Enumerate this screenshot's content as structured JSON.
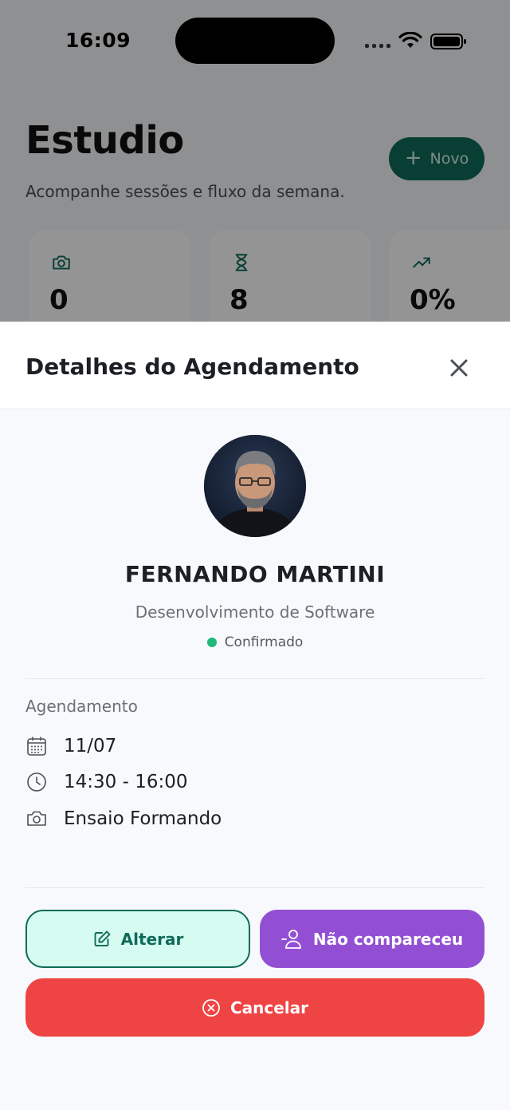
{
  "status_bar": {
    "time": "16:09"
  },
  "background": {
    "title": "Estudio",
    "subtitle": "Acompanhe sessões e fluxo da semana.",
    "new_button": "Novo",
    "stats": [
      {
        "icon": "camera-icon",
        "value": "0"
      },
      {
        "icon": "hourglass-icon",
        "value": "8"
      },
      {
        "icon": "trending-up-icon",
        "value": "0%"
      }
    ]
  },
  "sheet": {
    "title": "Detalhes do Agendamento",
    "client": {
      "name": "FERNANDO MARTINI",
      "service": "Desenvolvimento de Software",
      "status": "Confirmado"
    },
    "section_label": "Agendamento",
    "details": {
      "date": "11/07",
      "time": "14:30 - 16:00",
      "type": "Ensaio Formando"
    },
    "actions": {
      "alter": "Alterar",
      "no_show": "Não compareceu",
      "cancel": "Cancelar"
    }
  },
  "colors": {
    "primary": "#0f6b58",
    "status_confirmed": "#1db97a",
    "purple": "#934fd4",
    "danger": "#ef4444"
  }
}
